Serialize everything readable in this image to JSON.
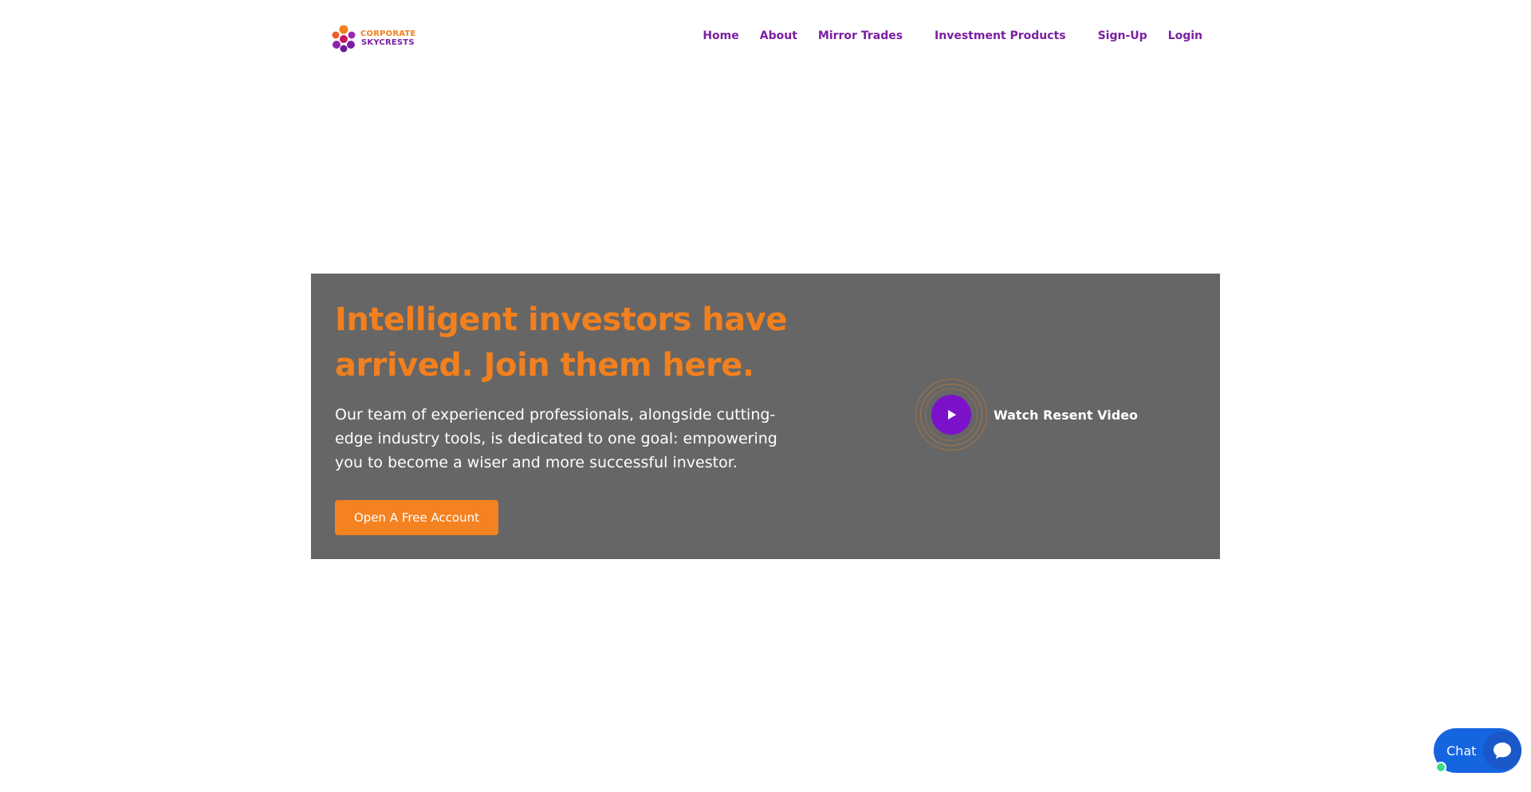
{
  "brand": {
    "line1": "CORPORATE",
    "line2": "SKYCRESTS",
    "colors": {
      "orange": "#f2801e",
      "purple": "#7b1fa2"
    }
  },
  "nav": {
    "items": [
      {
        "label": "Home"
      },
      {
        "label": "About"
      },
      {
        "label": "Mirror Trades"
      },
      {
        "label": "Investment Products"
      },
      {
        "label": "Sign-Up"
      },
      {
        "label": "Login"
      }
    ]
  },
  "hero": {
    "title": "Intelligent investors have arrived. Join them here.",
    "description": "Our team of experienced professionals, alongside cutting-edge industry tools, is dedicated to one goal: empowering you to become a wiser and more successful investor.",
    "cta_label": "Open A Free Account",
    "video_label": "Watch Resent Video",
    "background": "#666666",
    "play_icon": "play-icon"
  },
  "chat": {
    "label": "Chat",
    "icon": "chat-bubble-icon",
    "color": "#1565e0"
  }
}
